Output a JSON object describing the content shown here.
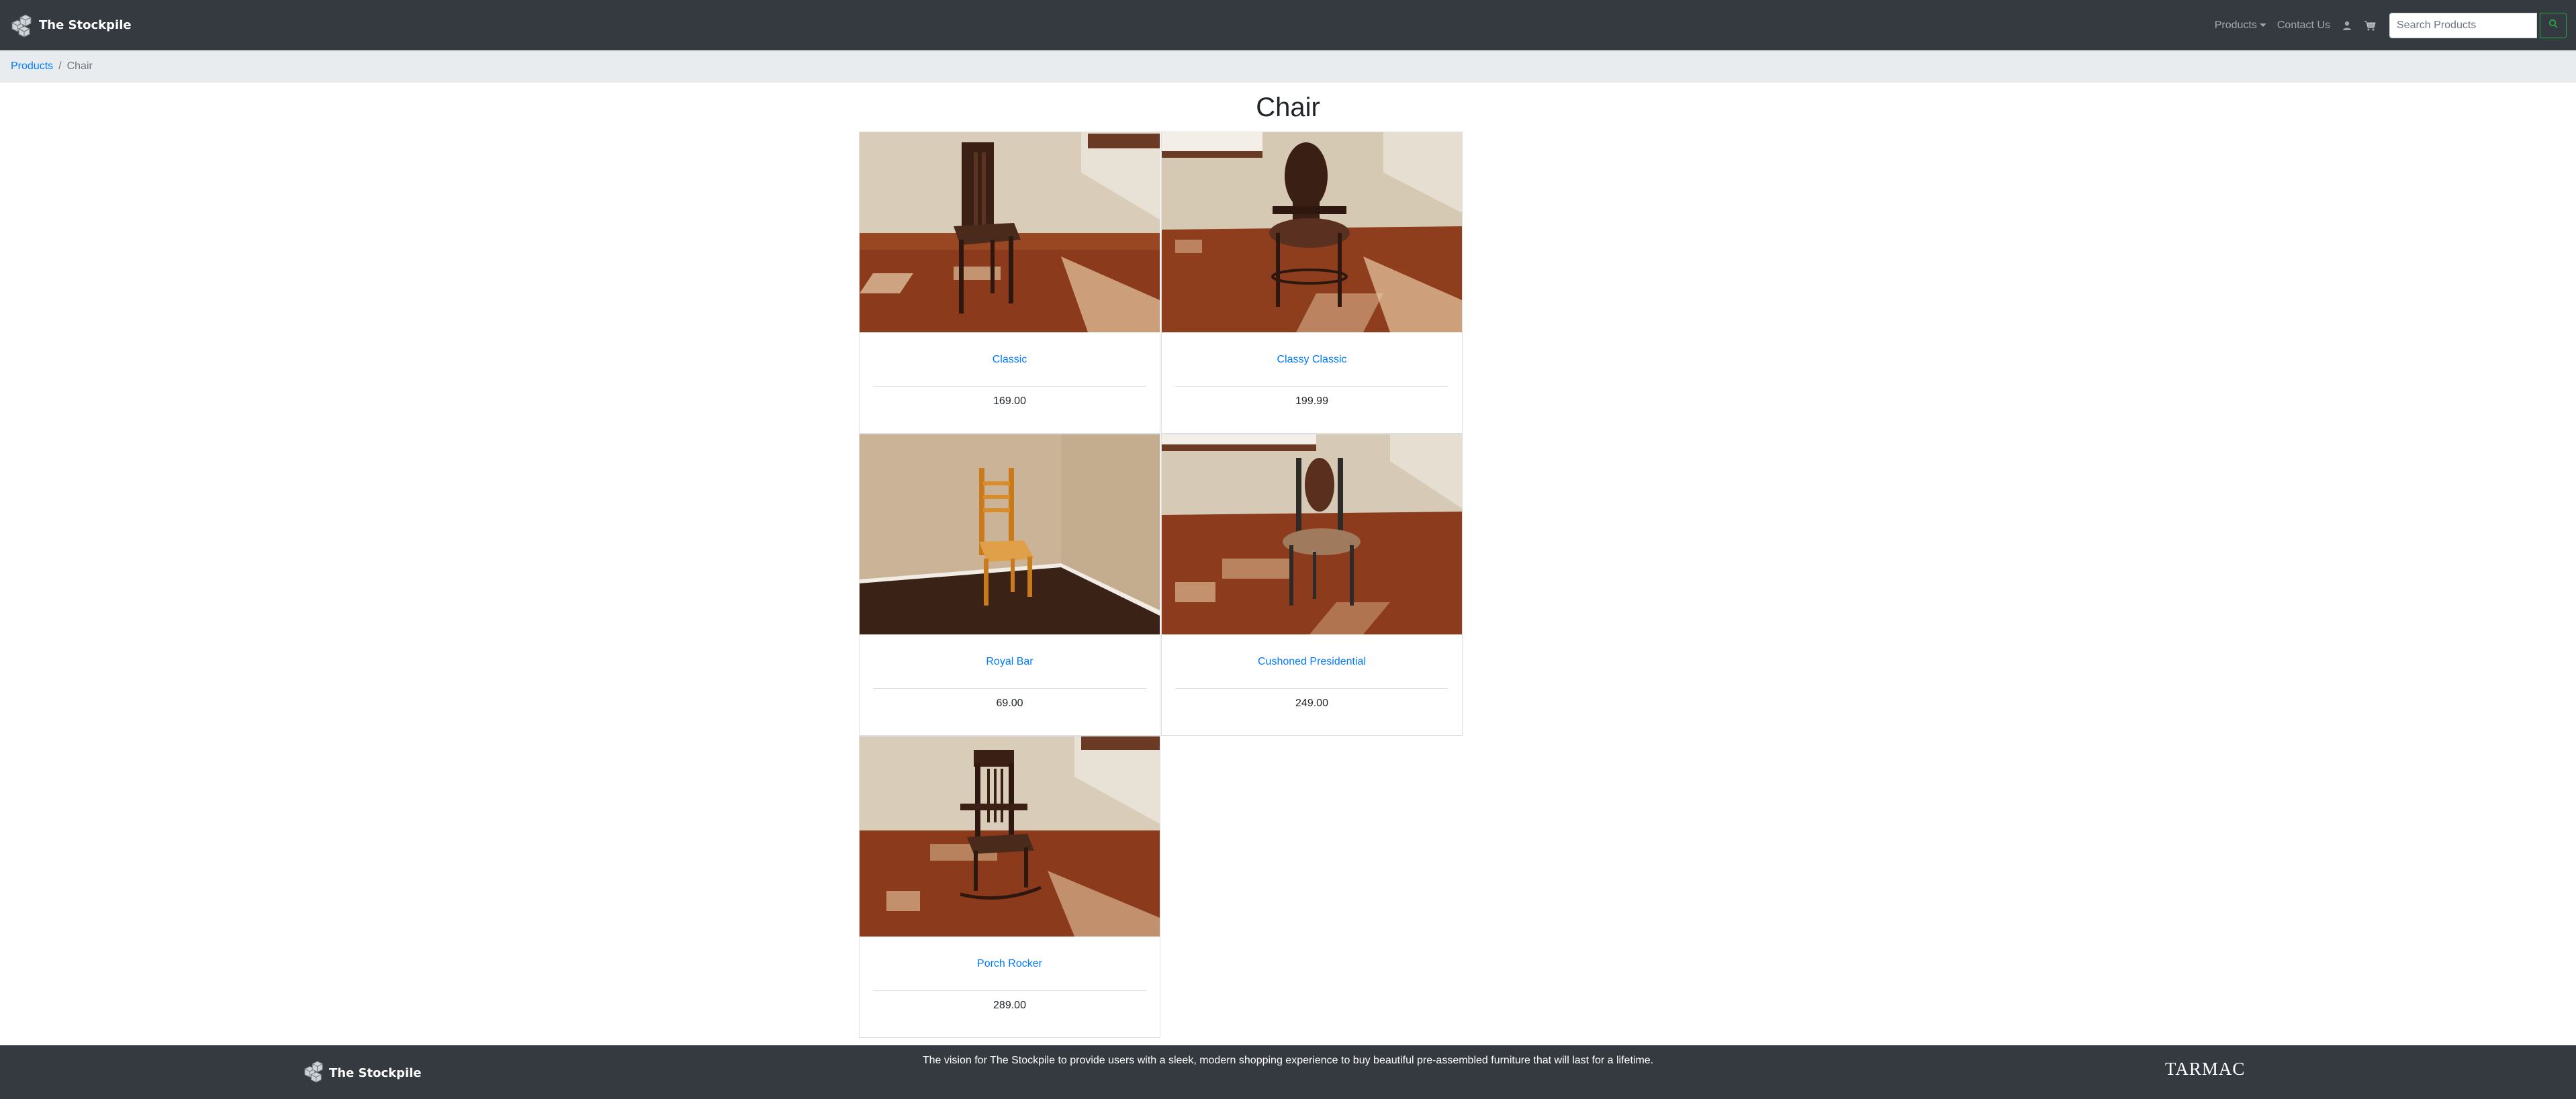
{
  "brand": {
    "name": "The Stockpile",
    "logo_icon": "cube-stack-icon"
  },
  "nav": {
    "products_label": "Products",
    "contact_label": "Contact Us",
    "account_icon": "person-icon",
    "cart_icon": "cart-icon",
    "search_placeholder": "Search Products",
    "search_icon": "search-icon",
    "search_button_color": "#28a745"
  },
  "breadcrumb": {
    "parent": "Products",
    "current": "Chair"
  },
  "page": {
    "title": "Chair"
  },
  "products": [
    {
      "name": "Classic",
      "price": "169.00"
    },
    {
      "name": "Classy Classic",
      "price": "199.99"
    },
    {
      "name": "Royal Bar",
      "price": "69.00"
    },
    {
      "name": "Cushoned Presidential",
      "price": "249.00"
    },
    {
      "name": "Porch Rocker",
      "price": "289.00"
    }
  ],
  "footer": {
    "brand": "The Stockpile",
    "vision": "The vision for The Stockpile to provide users with a sleek, modern shopping experience to buy beautiful pre-assembled furniture that will last for a lifetime.",
    "company": "TARMAC"
  },
  "colors": {
    "navbar": "#343a40",
    "link": "#007bff",
    "breadcrumb_bg": "#e9ecef"
  }
}
